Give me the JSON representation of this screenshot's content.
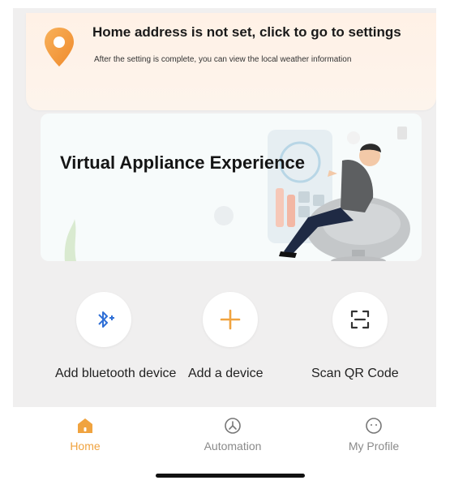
{
  "banner": {
    "title": "Home address is not set, click to go to settings",
    "subtitle": "After the setting is complete, you can view the local weather information",
    "icon": "location-pin-icon"
  },
  "promo": {
    "title": "Virtual Appliance Experience"
  },
  "actions": [
    {
      "id": "add-bluetooth",
      "label": "Add bluetooth device",
      "icon": "bluetooth-plus-icon"
    },
    {
      "id": "add-device",
      "label": "Add a device",
      "icon": "plus-icon"
    },
    {
      "id": "scan-qr",
      "label": "Scan QR Code",
      "icon": "scan-icon"
    }
  ],
  "tabs": [
    {
      "id": "home",
      "label": "Home",
      "icon": "home-icon",
      "active": true
    },
    {
      "id": "automation",
      "label": "Automation",
      "icon": "automation-icon",
      "active": false
    },
    {
      "id": "profile",
      "label": "My Profile",
      "icon": "profile-icon",
      "active": false
    }
  ],
  "colors": {
    "accent": "#f0a33f",
    "bluetooth": "#2f6fd6",
    "banner_bg": "#fff1e6",
    "screen_bg": "#f0efef"
  }
}
